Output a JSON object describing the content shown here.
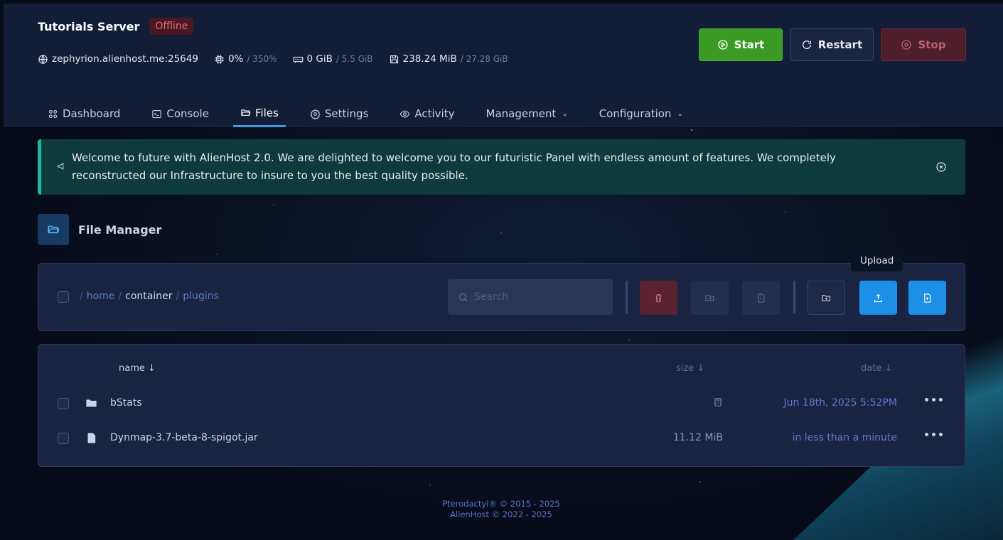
{
  "server": {
    "name": "Tutorials Server",
    "status": "Offline",
    "address": "zephyrion.alienhost.me:25649",
    "cpu": "0%",
    "cpu_limit": "/ 350%",
    "memory": "0 GiB",
    "memory_limit": "/ 5.5 GiB",
    "disk": "238.24 MiB",
    "disk_limit": "/ 27.28 GiB"
  },
  "power": {
    "start_label": "Start",
    "restart_label": "Restart",
    "stop_label": "Stop"
  },
  "nav": {
    "tabs": [
      {
        "label": "Dashboard"
      },
      {
        "label": "Console"
      },
      {
        "label": "Files"
      },
      {
        "label": "Settings"
      },
      {
        "label": "Activity"
      },
      {
        "label": "Management"
      },
      {
        "label": "Configuration"
      }
    ],
    "active": "Files"
  },
  "alert": {
    "text": "Welcome to future with AlienHost 2.0. We are delighted to welcome you to our futuristic Panel with endless amount of features. We completely reconstructed our Infrastructure to insure to you the best quality possible."
  },
  "file_manager": {
    "title": "File Manager",
    "breadcrumb": [
      "home",
      "container",
      "plugins"
    ],
    "search_placeholder": "Search",
    "tooltip": "Upload",
    "columns": {
      "name": "name ↓",
      "size": "size ↓",
      "date": "date ↓"
    },
    "files": [
      {
        "name": "bStats",
        "type": "folder",
        "size": "",
        "date": "Jun 18th, 2025 5:52PM"
      },
      {
        "name": "Dynmap-3.7-beta-8-spigot.jar",
        "type": "file",
        "size": "11.12 MiB",
        "date": "in less than a minute"
      }
    ]
  },
  "footer": {
    "line1": "Pterodactyl® © 2015 - 2025",
    "line2": "AlienHost © 2022 - 2025"
  },
  "colors": {
    "accent": "#1c8fe6",
    "start": "#3a9a23",
    "stop": "#4e1f2a",
    "alert": "#0f3a3c"
  }
}
